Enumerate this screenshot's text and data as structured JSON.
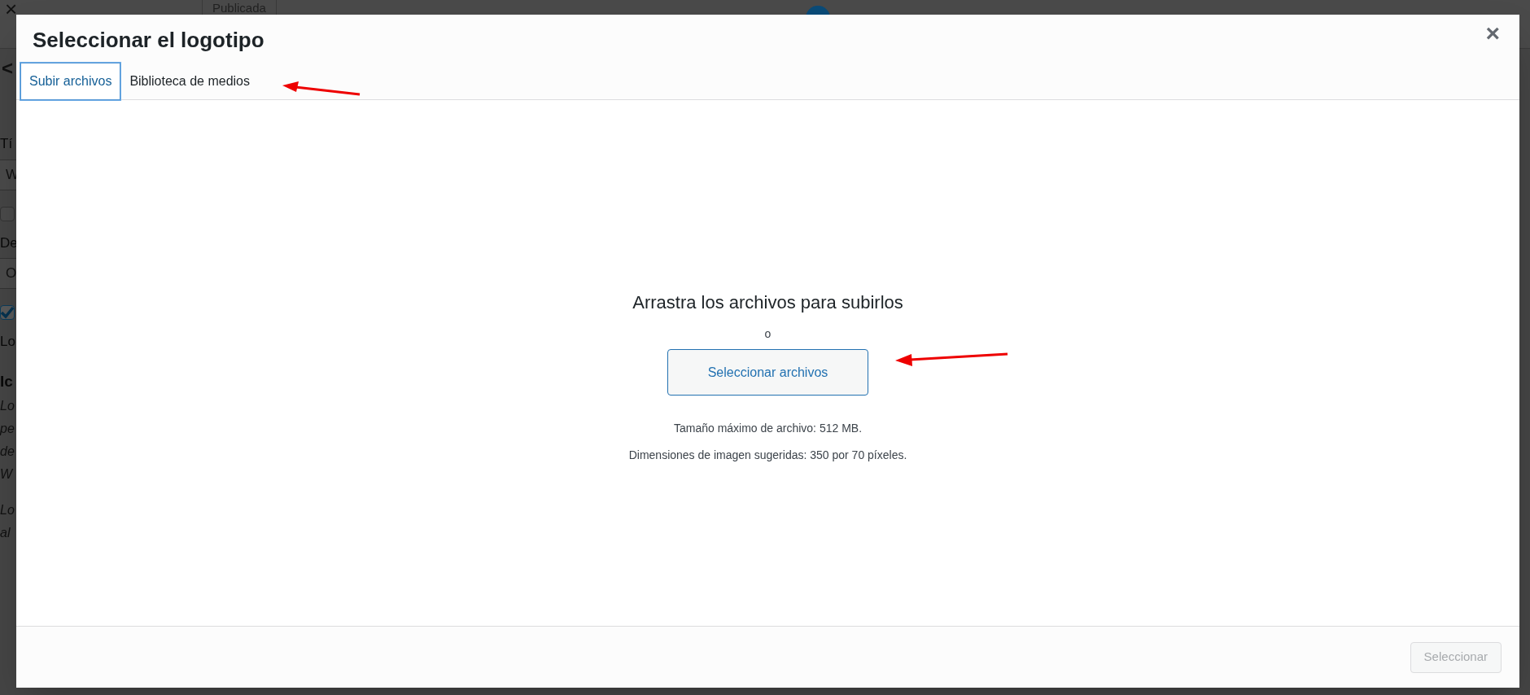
{
  "background": {
    "close_glyph": "×",
    "status": "Publicada",
    "back_glyph": "<",
    "fragments": [
      {
        "kind": "label",
        "text": "Tí"
      },
      {
        "kind": "input",
        "text": "W"
      },
      {
        "kind": "checkbox",
        "checked": false
      },
      {
        "kind": "label",
        "text": "De"
      },
      {
        "kind": "input",
        "text": "O"
      },
      {
        "kind": "checkbox",
        "checked": true
      },
      {
        "kind": "label",
        "text": "Lo"
      },
      {
        "kind": "heading",
        "text": "Ic"
      },
      {
        "kind": "italic",
        "text": "Lo"
      },
      {
        "kind": "italic",
        "text": "pe"
      },
      {
        "kind": "italic",
        "text": "de"
      },
      {
        "kind": "italic",
        "text": "W"
      },
      {
        "kind": "italic",
        "text": "Lo"
      },
      {
        "kind": "italic",
        "text": "al"
      }
    ]
  },
  "modal": {
    "title": "Seleccionar el logotipo",
    "close_glyph": "×",
    "tabs": [
      {
        "label": "Subir archivos",
        "selected": true
      },
      {
        "label": "Biblioteca de medios",
        "selected": false
      }
    ],
    "uploader": {
      "heading": "Arrastra los archivos para subirlos",
      "separator": "o",
      "button": "Seleccionar archivos",
      "notes": [
        "Tamaño máximo de archivo: 512 MB.",
        "Dimensiones de imagen sugeridas: 350 por 70 píxeles."
      ]
    },
    "footer": {
      "button": "Seleccionar",
      "disabled": true
    }
  }
}
